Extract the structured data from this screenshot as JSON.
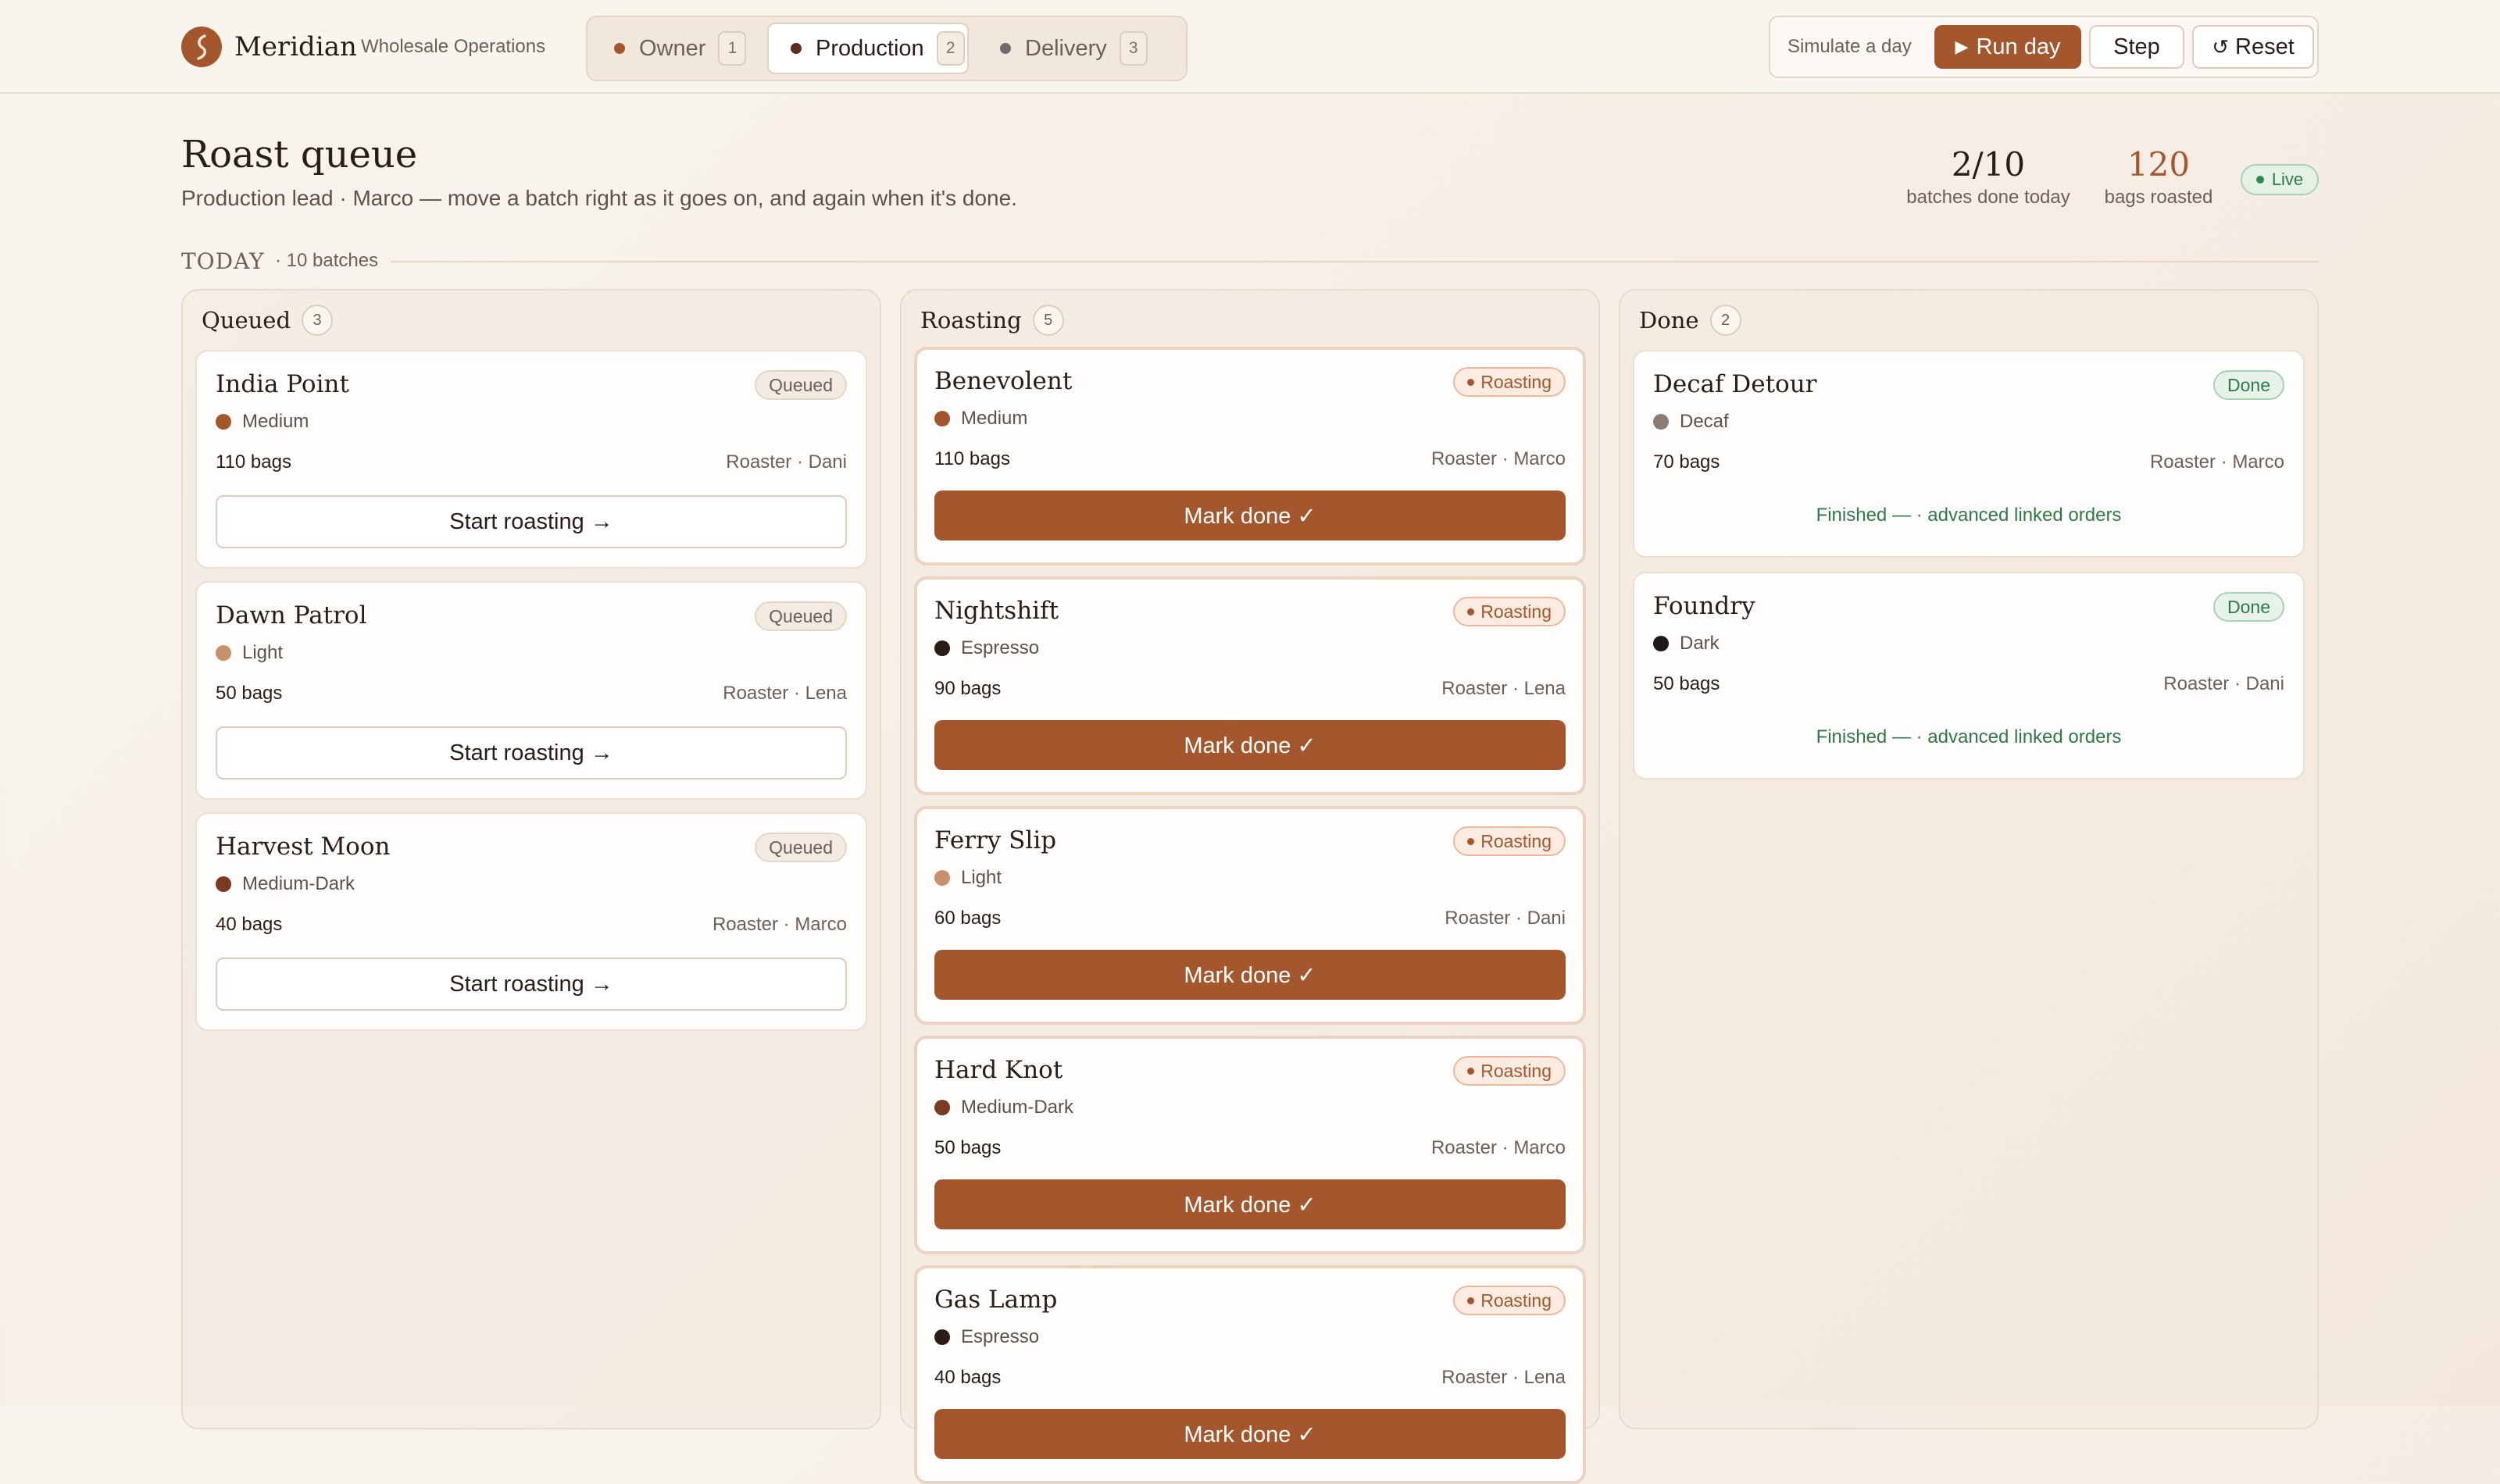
{
  "app": {
    "brand": "Meridian",
    "subtitle": "Wholesale Operations"
  },
  "roles": [
    {
      "label": "Owner",
      "count": "1",
      "active": false,
      "dot": "#a4562c"
    },
    {
      "label": "Production",
      "count": "2",
      "active": true,
      "dot": "#5a2e1c"
    },
    {
      "label": "Delivery",
      "count": "3",
      "active": false,
      "dot": "#6d6d6d"
    }
  ],
  "simulate": {
    "label": "Simulate a day",
    "run_label": "Run day",
    "step_label": "Step",
    "reset_label": "Reset"
  },
  "page": {
    "title": "Roast queue",
    "subtitle": "Production lead · Marco — move a batch right as it goes on, and again when it's done."
  },
  "stats": {
    "batches_value": "2/10",
    "batches_caption": "batches done today",
    "bags_value": "120",
    "bags_caption": "bags roasted",
    "live_label": "Live"
  },
  "today": {
    "label": "TODAY",
    "count": "· 10 batches"
  },
  "colors": {
    "accent": "#a4562c",
    "done_green": "#2d7a48",
    "roast_medium": "#a4562c",
    "roast_light": "#c9906c",
    "roast_medium_dark": "#7a3b22",
    "roast_espresso": "#2a1d17",
    "roast_dark": "#1f1a17",
    "roast_decaf": "#8a7e74"
  },
  "columns": [
    {
      "title": "Queued",
      "count": "3",
      "cards": [
        {
          "name": "India Point",
          "status": "Queued",
          "roast": "Medium",
          "roast_color": "#a4562c",
          "bags": "110 bags",
          "roaster": "Roaster · Dani",
          "action": "Start roasting →"
        },
        {
          "name": "Dawn Patrol",
          "status": "Queued",
          "roast": "Light",
          "roast_color": "#c9906c",
          "bags": "50 bags",
          "roaster": "Roaster · Lena",
          "action": "Start roasting →"
        },
        {
          "name": "Harvest Moon",
          "status": "Queued",
          "roast": "Medium-Dark",
          "roast_color": "#7a3b22",
          "bags": "40 bags",
          "roaster": "Roaster · Marco",
          "action": "Start roasting →"
        }
      ]
    },
    {
      "title": "Roasting",
      "count": "5",
      "cards": [
        {
          "name": "Benevolent",
          "status": "Roasting",
          "roast": "Medium",
          "roast_color": "#a4562c",
          "bags": "110 bags",
          "roaster": "Roaster · Marco",
          "action": "Mark done ✓"
        },
        {
          "name": "Nightshift",
          "status": "Roasting",
          "roast": "Espresso",
          "roast_color": "#2a1d17",
          "bags": "90 bags",
          "roaster": "Roaster · Lena",
          "action": "Mark done ✓"
        },
        {
          "name": "Ferry Slip",
          "status": "Roasting",
          "roast": "Light",
          "roast_color": "#c9906c",
          "bags": "60 bags",
          "roaster": "Roaster · Dani",
          "action": "Mark done ✓"
        },
        {
          "name": "Hard Knot",
          "status": "Roasting",
          "roast": "Medium-Dark",
          "roast_color": "#7a3b22",
          "bags": "50 bags",
          "roaster": "Roaster · Marco",
          "action": "Mark done ✓"
        },
        {
          "name": "Gas Lamp",
          "status": "Roasting",
          "roast": "Espresso",
          "roast_color": "#2a1d17",
          "bags": "40 bags",
          "roaster": "Roaster · Lena",
          "action": "Mark done ✓"
        }
      ]
    },
    {
      "title": "Done",
      "count": "2",
      "cards": [
        {
          "name": "Decaf Detour",
          "status": "Done",
          "roast": "Decaf",
          "roast_color": "#8a7e74",
          "bags": "70 bags",
          "roaster": "Roaster · Marco",
          "note": "Finished — · advanced linked orders"
        },
        {
          "name": "Foundry",
          "status": "Done",
          "roast": "Dark",
          "roast_color": "#1f1a17",
          "bags": "50 bags",
          "roaster": "Roaster · Dani",
          "note": "Finished — · advanced linked orders"
        }
      ]
    }
  ]
}
